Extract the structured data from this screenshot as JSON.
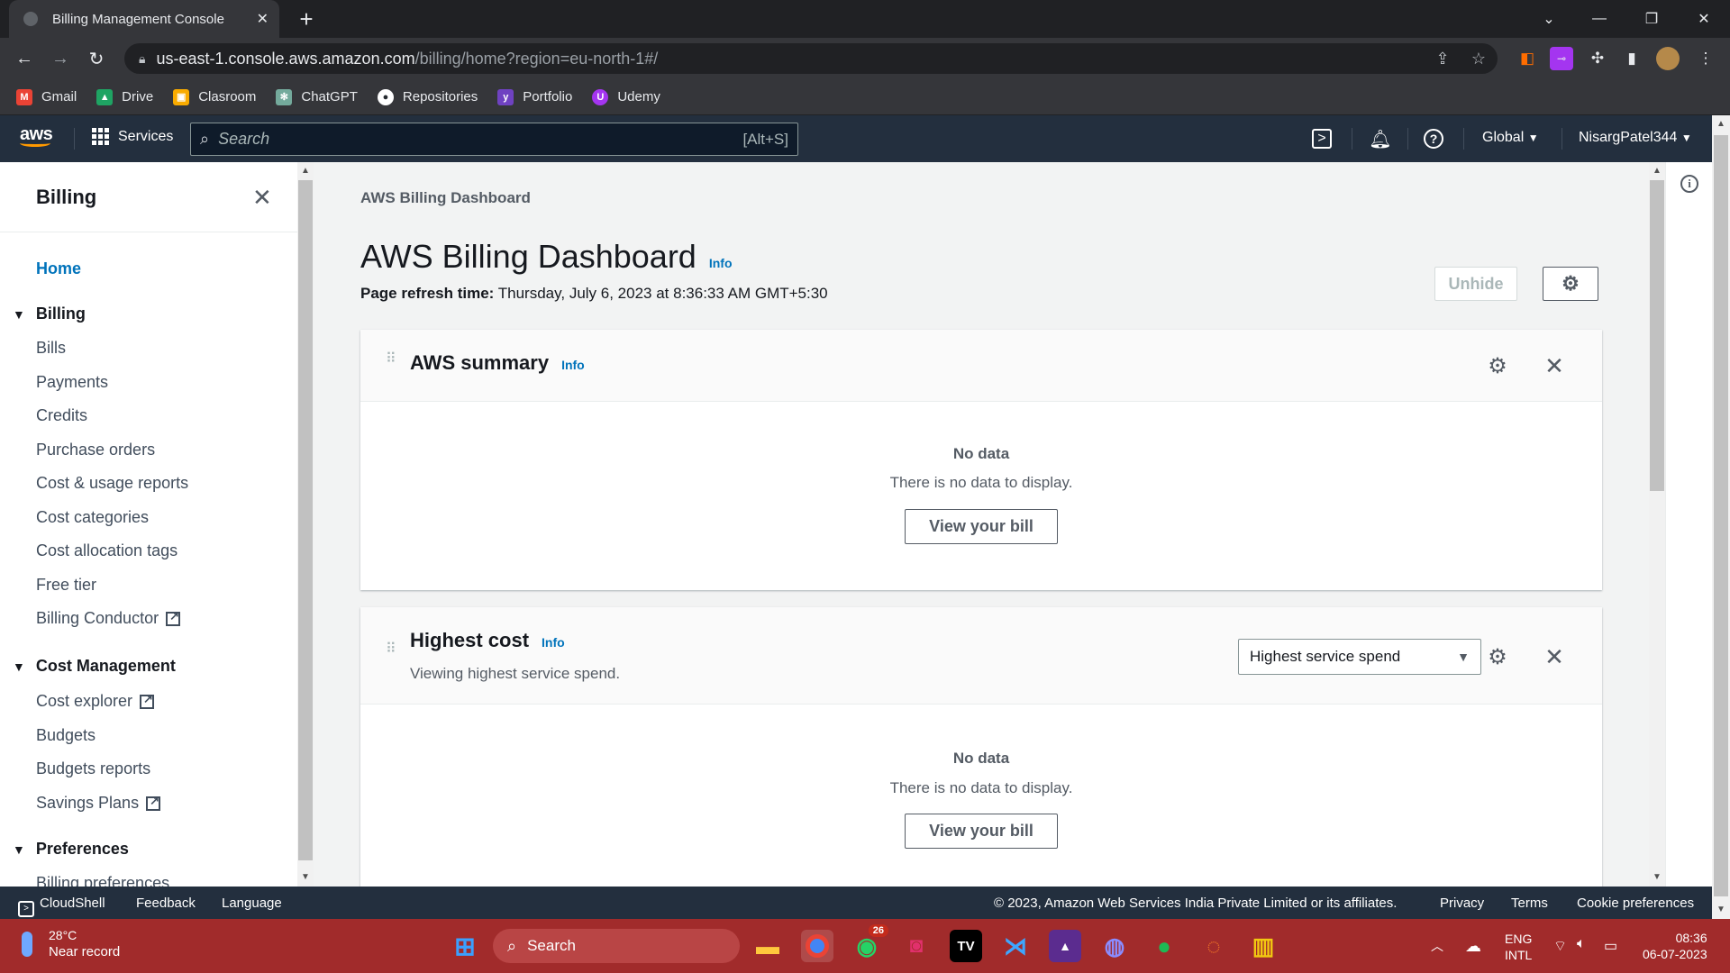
{
  "browser": {
    "tab_title": "Billing Management Console",
    "url_host": "us-east-1.console.aws.amazon.com",
    "url_path": "/billing/home?region=eu-north-1#/",
    "bookmarks": [
      {
        "label": "Gmail",
        "icon": "gmail-icon",
        "color": "#ea4335"
      },
      {
        "label": "Drive",
        "icon": "drive-icon",
        "color": "#1fa463"
      },
      {
        "label": "Clasroom",
        "icon": "classroom-icon",
        "color": "#f9ab00"
      },
      {
        "label": "ChatGPT",
        "icon": "chatgpt-icon",
        "color": "#74aa9c"
      },
      {
        "label": "Repositories",
        "icon": "github-icon",
        "color": "#24292f"
      },
      {
        "label": "Portfolio",
        "icon": "portfolio-icon",
        "color": "#6f42c1"
      },
      {
        "label": "Udemy",
        "icon": "udemy-icon",
        "color": "#a435f0"
      }
    ]
  },
  "aws_nav": {
    "logo": "aws",
    "services_label": "Services",
    "search_placeholder": "Search",
    "search_shortcut": "[Alt+S]",
    "region": "Global",
    "account": "NisargPatel344"
  },
  "sidebar": {
    "title": "Billing",
    "home": "Home",
    "sections": [
      {
        "label": "Billing",
        "items": [
          {
            "label": "Bills",
            "external": false
          },
          {
            "label": "Payments",
            "external": false
          },
          {
            "label": "Credits",
            "external": false
          },
          {
            "label": "Purchase orders",
            "external": false
          },
          {
            "label": "Cost & usage reports",
            "external": false
          },
          {
            "label": "Cost categories",
            "external": false
          },
          {
            "label": "Cost allocation tags",
            "external": false
          },
          {
            "label": "Free tier",
            "external": false
          },
          {
            "label": "Billing Conductor",
            "external": true
          }
        ]
      },
      {
        "label": "Cost Management",
        "items": [
          {
            "label": "Cost explorer",
            "external": true
          },
          {
            "label": "Budgets",
            "external": false
          },
          {
            "label": "Budgets reports",
            "external": false
          },
          {
            "label": "Savings Plans",
            "external": true
          }
        ]
      },
      {
        "label": "Preferences",
        "items": [
          {
            "label": "Billing preferences",
            "external": false
          }
        ]
      }
    ]
  },
  "main": {
    "breadcrumb": "AWS Billing Dashboard",
    "title": "AWS Billing Dashboard",
    "info": "Info",
    "refresh_label": "Page refresh time:",
    "refresh_value": "Thursday, July 6, 2023 at 8:36:33 AM GMT+5:30",
    "unhide_label": "Unhide",
    "panels": [
      {
        "title": "AWS summary",
        "info": "Info",
        "nodata_title": "No data",
        "nodata_desc": "There is no data to display.",
        "button": "View your bill"
      },
      {
        "title": "Highest cost",
        "info": "Info",
        "subtitle": "Viewing highest service spend.",
        "select_value": "Highest service spend",
        "nodata_title": "No data",
        "nodata_desc": "There is no data to display.",
        "button": "View your bill"
      }
    ]
  },
  "footer": {
    "cloudshell": "CloudShell",
    "feedback": "Feedback",
    "language": "Language",
    "copyright": "© 2023, Amazon Web Services India Private Limited or its affiliates.",
    "privacy": "Privacy",
    "terms": "Terms",
    "cookie": "Cookie preferences"
  },
  "taskbar": {
    "temp": "28°C",
    "weather": "Near record",
    "search": "Search",
    "whatsapp_badge": "26",
    "lang1": "ENG",
    "lang2": "INTL",
    "time": "08:36",
    "date": "06-07-2023"
  },
  "colors": {
    "aws_nav_bg": "#232f3e",
    "link_blue": "#0073bb",
    "aws_orange": "#ff9900",
    "taskbar_bg": "#a12b2b"
  }
}
